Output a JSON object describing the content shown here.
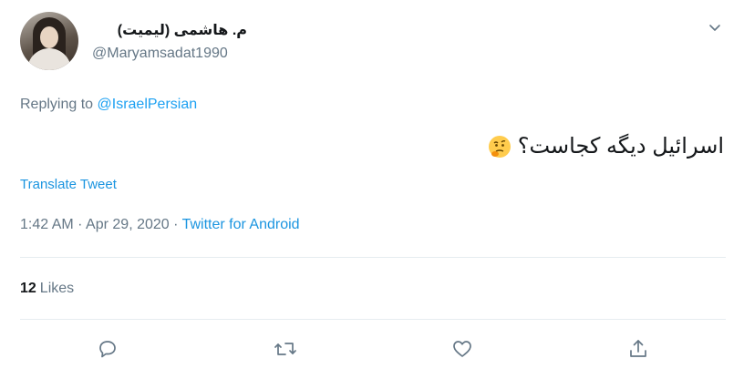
{
  "tweet": {
    "display_name": "م. هاشمی (لیمیت)",
    "handle": "@Maryamsadat1990",
    "replying_prefix": "Replying to",
    "replying_to": "@IsraelPersian",
    "text": "اسرائیل دیگه کجاست؟",
    "emoji": "thinking-face",
    "translate_label": "Translate Tweet",
    "time": "1:42 AM",
    "date": "Apr 29, 2020",
    "separator": "·",
    "source": "Twitter for Android",
    "likes_count": "12",
    "likes_label": "Likes"
  },
  "icons": {
    "menu": "chevron-down-icon",
    "reply": "reply-icon",
    "retweet": "retweet-icon",
    "like": "heart-icon",
    "share": "share-icon"
  },
  "colors": {
    "link": "#1da1f2",
    "muted": "#657786",
    "text": "#14171a",
    "divider": "#e6ecf0"
  }
}
